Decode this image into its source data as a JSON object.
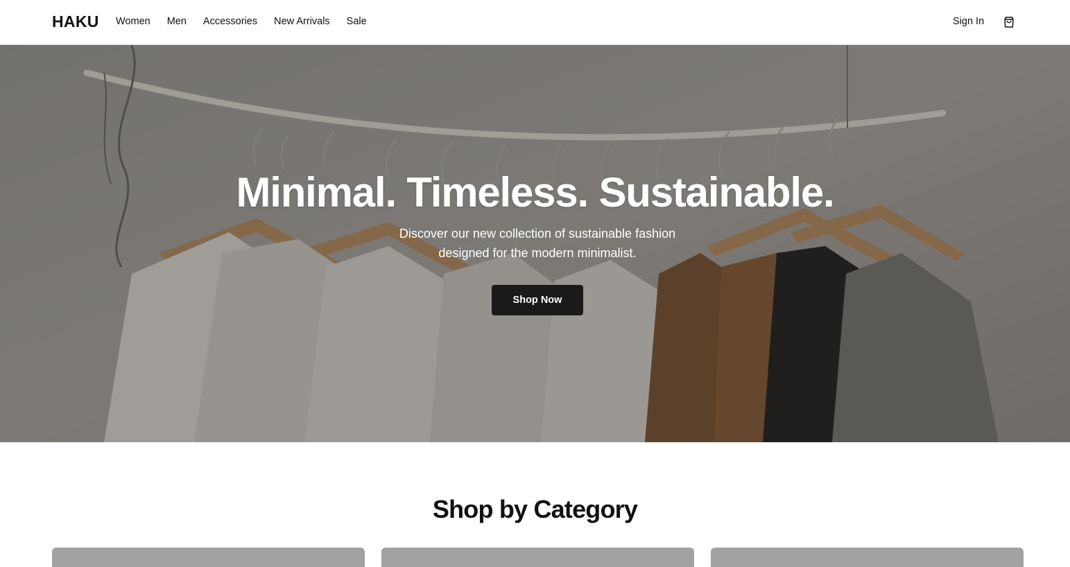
{
  "header": {
    "logo": "HAKU",
    "nav": [
      "Women",
      "Men",
      "Accessories",
      "New Arrivals",
      "Sale"
    ],
    "sign_in": "Sign In",
    "cart_icon": "shopping-bag-icon"
  },
  "hero": {
    "title": "Minimal. Timeless. Sustainable.",
    "subtitle": "Discover our new collection of sustainable fashion designed for the modern minimalist.",
    "cta_label": "Shop Now",
    "image_description": "clothes on wooden hangers on a white branch rail"
  },
  "categories": {
    "title": "Shop by Category",
    "cards": [
      {},
      {},
      {}
    ]
  },
  "colors": {
    "text": "#111111",
    "button_bg": "#1c1a19",
    "card_placeholder": "#a2a2a2",
    "border": "#d9d9d9"
  }
}
